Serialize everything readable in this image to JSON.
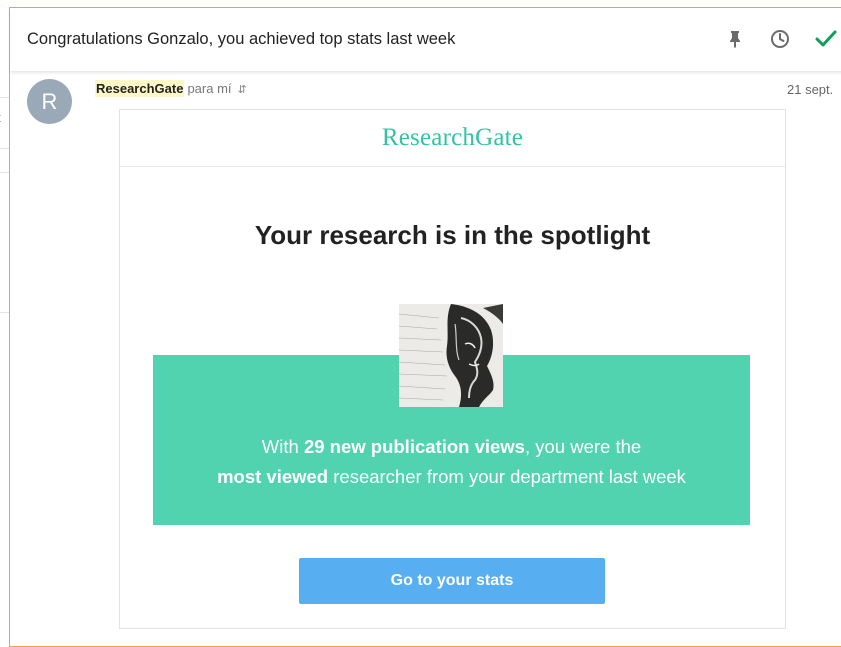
{
  "email": {
    "subject": "Congratulations Gonzalo, you achieved top stats last week",
    "toolbar": {
      "pin_icon": "pin-icon",
      "snooze_icon": "clock-icon",
      "done_icon": "checkmark-icon",
      "done_color": "#0f9d58"
    },
    "sender": {
      "avatar_letter": "R",
      "name": "ResearchGate",
      "recipient": "para mí",
      "details_icon": "expand-details-icon"
    },
    "date": "21 sept."
  },
  "message": {
    "brand": "ResearchGate",
    "headline": "Your research is in the spotlight",
    "portrait_label": "researcher-portrait",
    "spotlight": {
      "line1_prefix": "With ",
      "line1_bold": "29 new publication views",
      "line1_suffix": ", you were the",
      "line2_bold": "most viewed",
      "line2_suffix": " researcher from your department last week"
    },
    "cta_label": "Go to your stats"
  },
  "colors": {
    "brand_green": "#33c2a4",
    "spotlight_bg": "#52d3b0",
    "cta_bg": "#57aef0",
    "focus_frame": "#f2a23c"
  },
  "background": {
    "left_fragment_char": "t"
  }
}
